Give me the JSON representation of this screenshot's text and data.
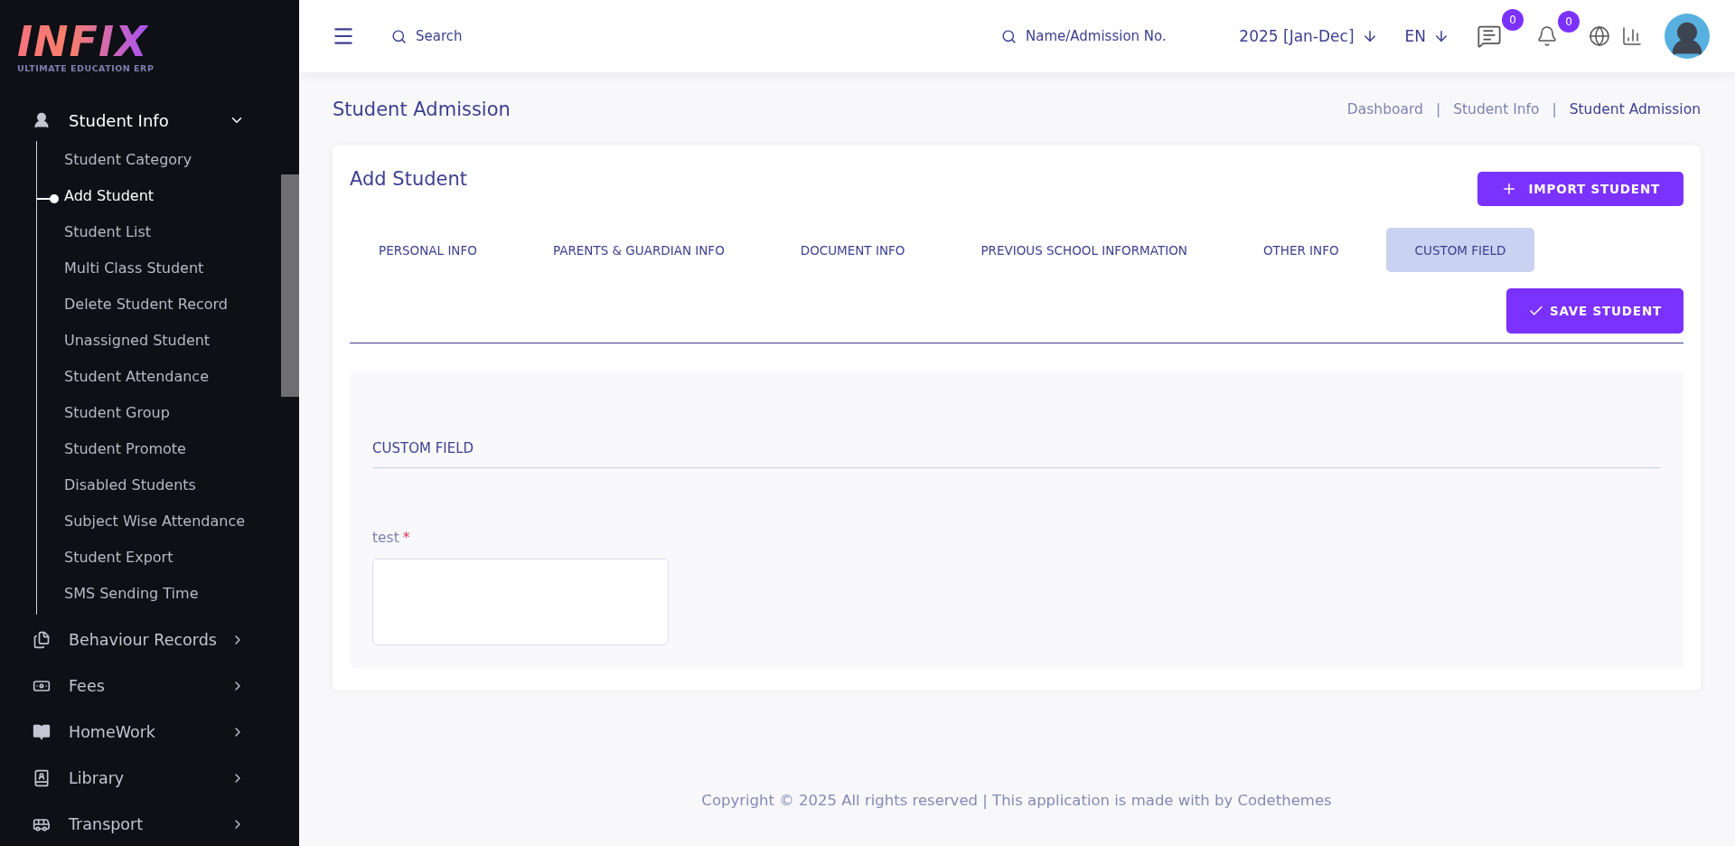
{
  "logo": {
    "title": "INFIX",
    "subtitle": "ULTIMATE EDUCATION ERP"
  },
  "sidebar": {
    "items": [
      {
        "label": "Student Info",
        "expanded": true,
        "children": [
          {
            "label": "Student Category",
            "selected": false
          },
          {
            "label": "Add Student",
            "selected": true
          },
          {
            "label": "Student List",
            "selected": false
          },
          {
            "label": "Multi Class Student",
            "selected": false
          },
          {
            "label": "Delete Student Record",
            "selected": false
          },
          {
            "label": "Unassigned Student",
            "selected": false
          },
          {
            "label": "Student Attendance",
            "selected": false
          },
          {
            "label": "Student Group",
            "selected": false
          },
          {
            "label": "Student Promote",
            "selected": false
          },
          {
            "label": "Disabled Students",
            "selected": false
          },
          {
            "label": "Subject Wise Attendance",
            "selected": false
          },
          {
            "label": "Student Export",
            "selected": false
          },
          {
            "label": "SMS Sending Time",
            "selected": false
          }
        ]
      },
      {
        "label": "Behaviour Records",
        "expanded": false
      },
      {
        "label": "Fees",
        "expanded": false
      },
      {
        "label": "HomeWork",
        "expanded": false
      },
      {
        "label": "Library",
        "expanded": false
      },
      {
        "label": "Transport",
        "expanded": false
      }
    ]
  },
  "header": {
    "search": {
      "placeholder": "Search"
    },
    "student_search": {
      "placeholder": "Name/Admission No."
    },
    "session": "2025 [Jan-Dec]",
    "language": "EN",
    "message_count": "0",
    "notification_count": "0"
  },
  "page": {
    "title": "Student Admission",
    "separator": "|",
    "breadcrumbs": [
      "Dashboard",
      "Student Info",
      "Student Admission"
    ]
  },
  "card": {
    "title": "Add Student",
    "import_button": "IMPORT STUDENT",
    "save_button": "SAVE STUDENT",
    "tabs": [
      {
        "label": "PERSONAL INFO",
        "selected": false
      },
      {
        "label": "PARENTS & GUARDIAN INFO",
        "selected": false
      },
      {
        "label": "DOCUMENT INFO",
        "selected": false
      },
      {
        "label": "PREVIOUS SCHOOL INFORMATION",
        "selected": false
      },
      {
        "label": "OTHER INFO",
        "selected": false
      },
      {
        "label": "CUSTOM FIELD",
        "selected": true
      }
    ],
    "section": {
      "title": "CUSTOM FIELD",
      "fields": [
        {
          "label": "test",
          "required": true,
          "required_mark": "*"
        }
      ]
    }
  },
  "footer": "Copyright © 2025 All rights reserved | This application is made with by Codethemes"
}
